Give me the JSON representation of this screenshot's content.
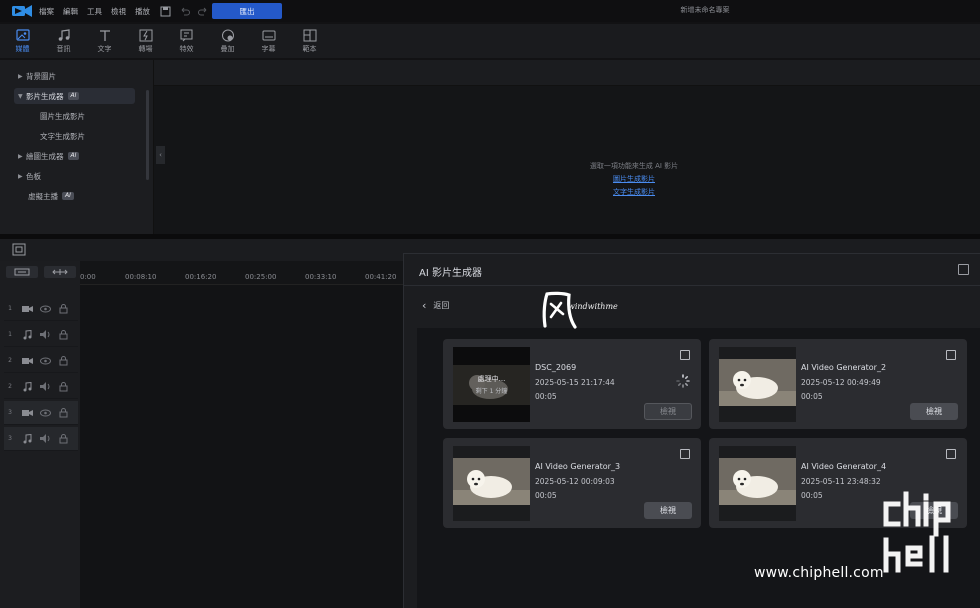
{
  "menubar": {
    "items": [
      "檔案",
      "編輯",
      "工具",
      "檢視",
      "播放"
    ],
    "export_label": "匯出",
    "project_title": "新增未命名專案"
  },
  "toolbar": {
    "tabs": [
      {
        "label": "媒體",
        "icon": "media-icon",
        "active": true
      },
      {
        "label": "音訊",
        "icon": "music-icon"
      },
      {
        "label": "文字",
        "icon": "text-icon"
      },
      {
        "label": "轉場",
        "icon": "transition-icon"
      },
      {
        "label": "特效",
        "icon": "effect-icon"
      },
      {
        "label": "疊加",
        "icon": "overlay-icon"
      },
      {
        "label": "字幕",
        "icon": "subtitle-icon"
      },
      {
        "label": "範本",
        "icon": "template-icon"
      }
    ]
  },
  "library": {
    "items": [
      {
        "label": "背景圖片",
        "type": "collapsed"
      },
      {
        "label": "影片生成器",
        "type": "expanded-selected",
        "badge": "AI"
      },
      {
        "label": "圖片生成影片",
        "type": "sub"
      },
      {
        "label": "文字生成影片",
        "type": "sub"
      },
      {
        "label": "繪圖生成器",
        "type": "collapsed",
        "badge": "AI"
      },
      {
        "label": "色板",
        "type": "collapsed"
      },
      {
        "label": "虛擬主播",
        "type": "plain",
        "badge": "AI"
      }
    ]
  },
  "preview": {
    "hint": "選取一項功能來生成 AI 影片",
    "link1": "圖片生成影片",
    "link2": "文字生成影片"
  },
  "timeline": {
    "ticks": [
      "0:00",
      "00:08:10",
      "00:16:20",
      "00:25:00",
      "00:33:10",
      "00:41:20"
    ],
    "tracks": [
      {
        "num": "1",
        "kind": "video"
      },
      {
        "num": "1",
        "kind": "audio"
      },
      {
        "num": "2",
        "kind": "video"
      },
      {
        "num": "2",
        "kind": "audio"
      },
      {
        "num": "3",
        "kind": "video"
      },
      {
        "num": "3",
        "kind": "audio"
      }
    ]
  },
  "dialog": {
    "title": "AI 影片生成器",
    "back_label": "返回",
    "cards": [
      {
        "name": "DSC_2069",
        "date": "2025-05-15 21:17:44",
        "duration": "00:05",
        "view_label": "檢視",
        "processing": true,
        "processing_text": "處理中...",
        "remaining_text": "剩下 1 分鐘"
      },
      {
        "name": "AI Video Generator_2",
        "date": "2025-05-12 00:49:49",
        "duration": "00:05",
        "view_label": "檢視",
        "processing": false
      },
      {
        "name": "AI Video Generator_3",
        "date": "2025-05-12 00:09:03",
        "duration": "00:05",
        "view_label": "檢視",
        "processing": false
      },
      {
        "name": "AI Video Generator_4",
        "date": "2025-05-11 23:48:32",
        "duration": "00:05",
        "view_label": "檢視",
        "processing": false
      }
    ]
  },
  "watermarks": {
    "author": "windwithme",
    "site": "www.chiphell.com",
    "logo_text": "chiphell"
  },
  "colors": {
    "accent": "#2459c9",
    "link": "#4a8cf0",
    "panel": "#1c1d20",
    "card": "#2b2c30"
  }
}
